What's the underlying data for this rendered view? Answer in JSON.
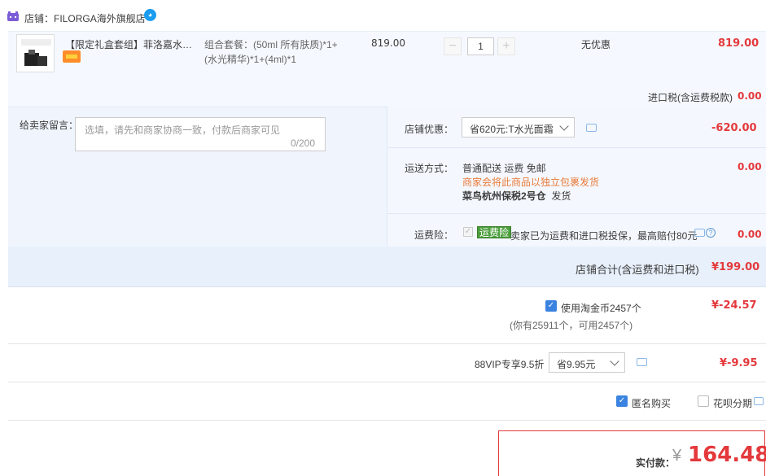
{
  "shop": {
    "prefix": "店铺：",
    "name": "FILORGA海外旗舰店"
  },
  "item": {
    "title": "【限定礼盒套组】菲洛嘉水光套...",
    "sku_line1": "组合套餐：(50ml 所有肤质)*1+",
    "sku_line2": "(水光精华)*1+(4ml)*1",
    "unit_price": "819.00",
    "quantity": "1",
    "minus": "−",
    "plus": "+",
    "discount": "无优惠",
    "total": "819.00",
    "tax_label": "进口税(含运费税款)",
    "tax_value": "0.00"
  },
  "message": {
    "label": "给卖家留言：",
    "placeholder": "选填，请先和商家协商一致，付款后商家可见",
    "count": "0/200"
  },
  "shop_discount": {
    "label": "店铺优惠：",
    "selected": "省620元:T水光面霜",
    "value": "-620.00"
  },
  "shipping": {
    "label": "运送方式：",
    "line1": "普通配送 运费 免邮",
    "line2": "商家会将此商品以独立包裹发货",
    "line3_bold": "菜鸟杭州保税2号仓",
    "line3_rest": "发货",
    "value": "0.00"
  },
  "insurance": {
    "label": "运费险：",
    "badge": "运费险",
    "text": "卖家已为运费和进口税投保，最高赔付80元",
    "value": "0.00"
  },
  "shop_total": {
    "label": "店铺合计(含运费和进口税)",
    "value": "¥199.00"
  },
  "coins": {
    "label": "使用淘金币2457个",
    "sub": "(你有25911个，可用2457个)",
    "value": "¥-24.57"
  },
  "vip": {
    "label": "88VIP专享9.5折",
    "selected": "省9.95元",
    "value": "¥-9.95"
  },
  "options": {
    "anonymous": "匿名购买",
    "huabei": "花呗分期"
  },
  "payment": {
    "label": "实付款：",
    "currency": "¥",
    "value": "164.48"
  }
}
